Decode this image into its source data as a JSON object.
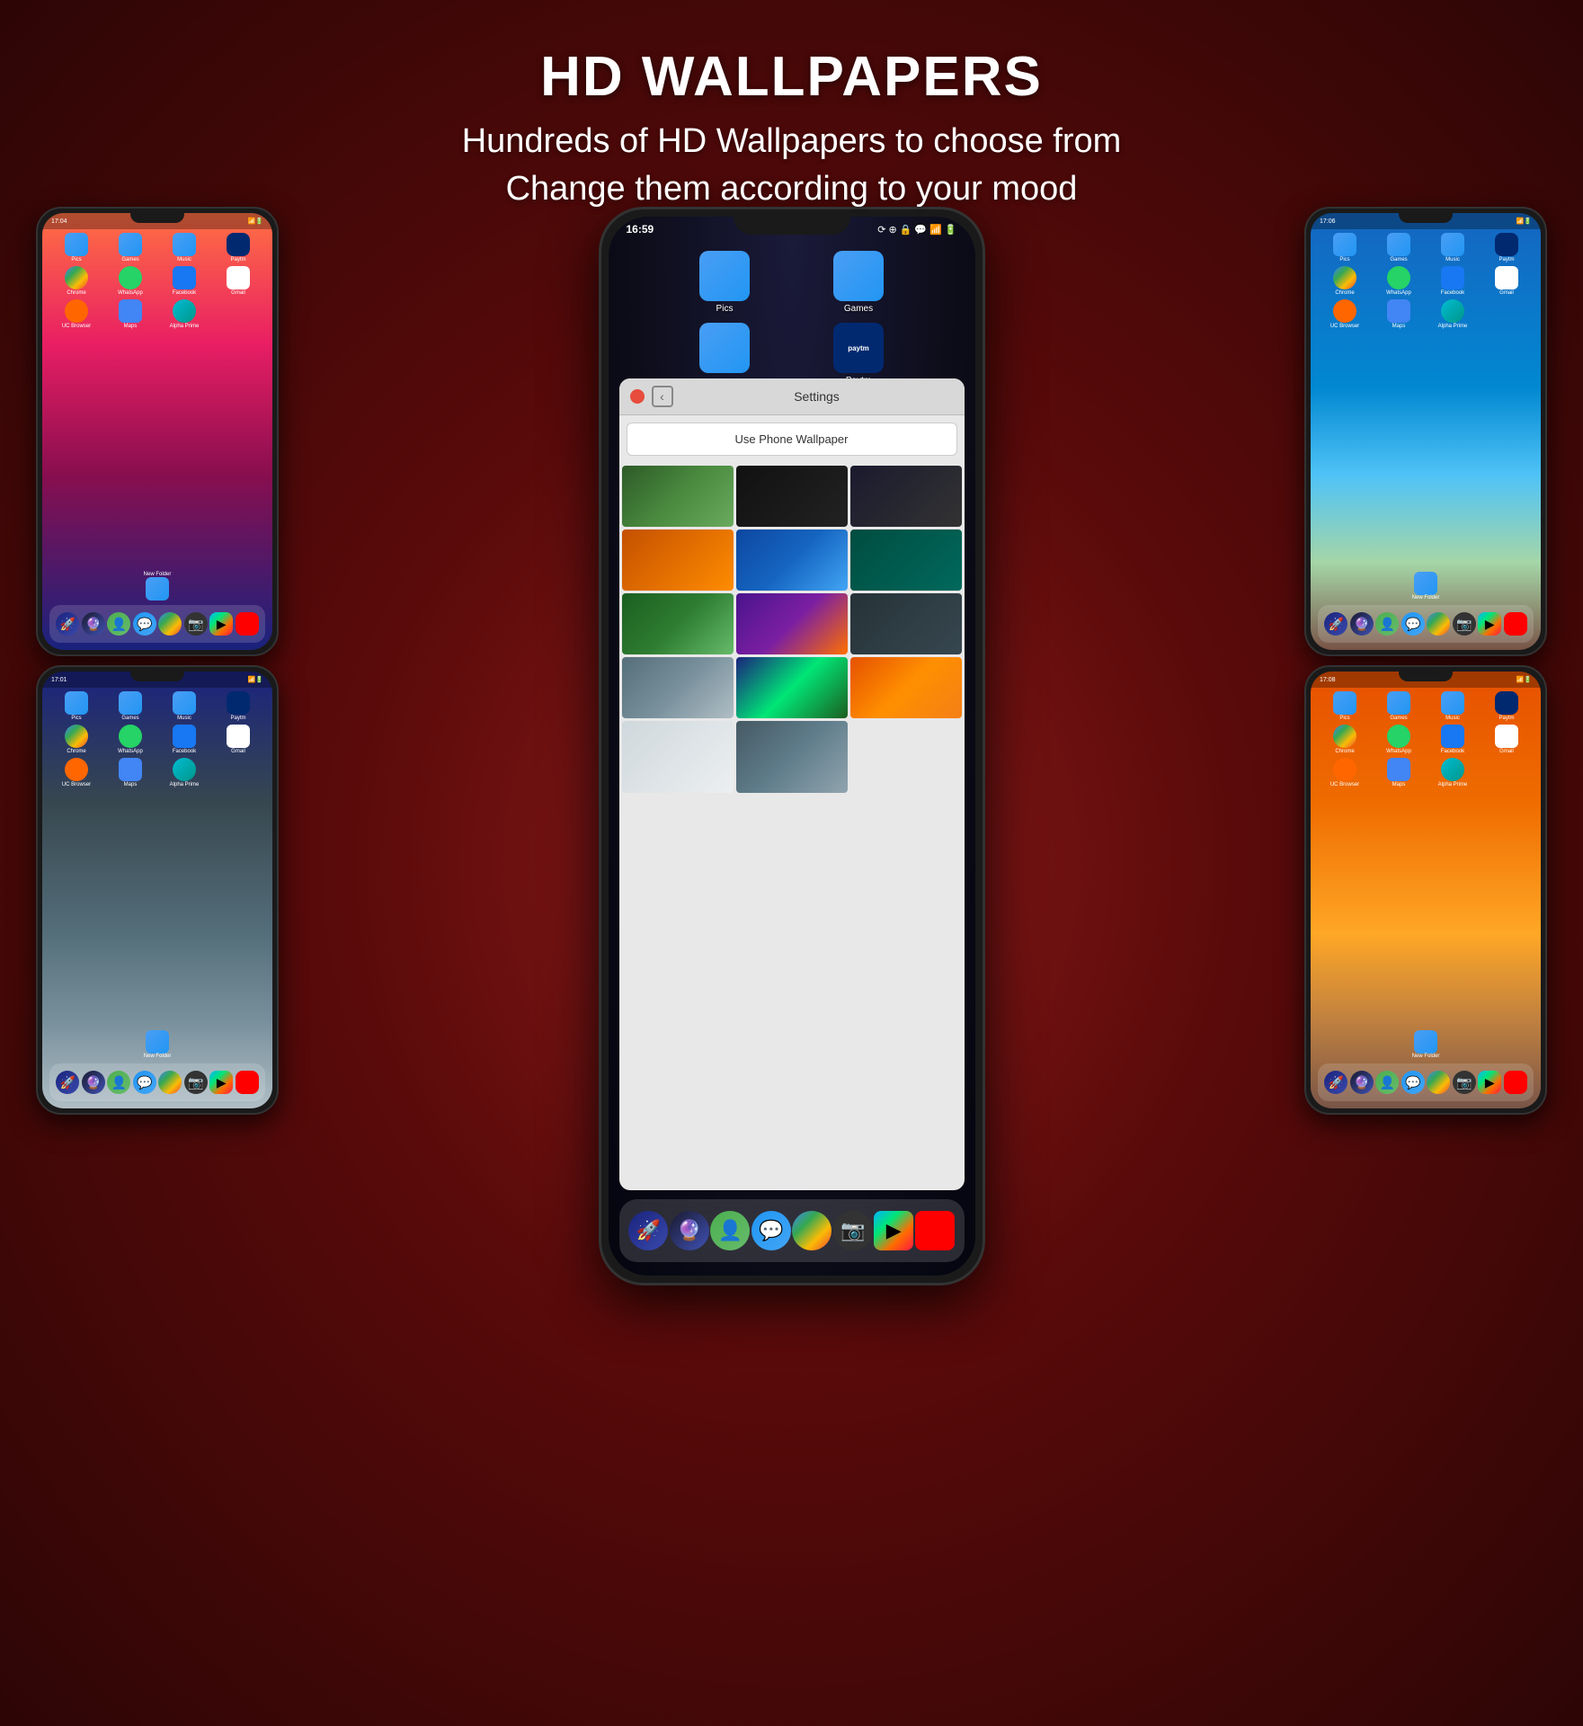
{
  "header": {
    "title": "HD WALLPAPERS",
    "subtitle_line1": "Hundreds of HD Wallpapers to choose from",
    "subtitle_line2": "Change them according to your mood"
  },
  "center_phone": {
    "status_time": "16:59",
    "folders": [
      {
        "label": "Pics"
      },
      {
        "label": "Games"
      },
      {
        "label": ""
      },
      {
        "label": ""
      }
    ],
    "settings": {
      "title": "Settings",
      "use_wallpaper_btn": "Use Phone Wallpaper"
    },
    "dock_icons": [
      "🚀",
      "🔮",
      "👤",
      "💬",
      "🌐",
      "📷",
      "▶",
      "🎬"
    ]
  },
  "top_left_phone": {
    "status_time": "17:04",
    "wallpaper": "sunset-boat",
    "apps": [
      {
        "label": "Pics"
      },
      {
        "label": "Games"
      },
      {
        "label": "Music"
      },
      {
        "label": "Paytm"
      },
      {
        "label": "Chrome"
      },
      {
        "label": "WhatsApp"
      },
      {
        "label": "Facebook"
      },
      {
        "label": "Gmail"
      },
      {
        "label": "UC Browser"
      },
      {
        "label": "Maps"
      },
      {
        "label": "Alpha Prime"
      },
      {
        "label": ""
      },
      {
        "label": "New Folder"
      }
    ]
  },
  "top_right_phone": {
    "status_time": "17:06",
    "wallpaper": "beach-cliff",
    "apps": [
      {
        "label": "Pics"
      },
      {
        "label": "Games"
      },
      {
        "label": "Music"
      },
      {
        "label": "Paytm"
      },
      {
        "label": "Chrome"
      },
      {
        "label": "WhatsApp"
      },
      {
        "label": "Facebook"
      },
      {
        "label": "Gmail"
      },
      {
        "label": "UC Browser"
      },
      {
        "label": "Maps"
      },
      {
        "label": "Alpha Prime"
      },
      {
        "label": ""
      },
      {
        "label": "New Folder"
      }
    ]
  },
  "bot_left_phone": {
    "status_time": "17:01",
    "wallpaper": "mountain-snow",
    "apps": [
      {
        "label": "Pics"
      },
      {
        "label": "Games"
      },
      {
        "label": "Music"
      },
      {
        "label": "Paytm"
      },
      {
        "label": "Chrome"
      },
      {
        "label": "WhatsApp"
      },
      {
        "label": "Facebook"
      },
      {
        "label": "Gmail"
      },
      {
        "label": "UC Browser"
      },
      {
        "label": "Maps"
      },
      {
        "label": "Alpha Prime"
      },
      {
        "label": ""
      },
      {
        "label": "New Folder"
      }
    ]
  },
  "bot_right_phone": {
    "status_time": "17:08",
    "wallpaper": "balloon-sunset",
    "apps": [
      {
        "label": "Pics"
      },
      {
        "label": "Games"
      },
      {
        "label": "Music"
      },
      {
        "label": "Paytm"
      },
      {
        "label": "Chrome"
      },
      {
        "label": "WhatsApp"
      },
      {
        "label": "Facebook"
      },
      {
        "label": "Gmail"
      },
      {
        "label": "UC Browser"
      },
      {
        "label": "Maps"
      },
      {
        "label": "Alpha Prime"
      },
      {
        "label": ""
      },
      {
        "label": "New Folder"
      }
    ]
  },
  "wallpaper_grid": [
    {
      "type": "wt-flowers",
      "label": "flowers"
    },
    {
      "type": "wt-dark",
      "label": "dark"
    },
    {
      "type": "wt-dark2",
      "label": "dark2"
    },
    {
      "type": "wt-orange",
      "label": "road"
    },
    {
      "type": "wt-ocean",
      "label": "ocean"
    },
    {
      "type": "wt-teal",
      "label": "teal"
    },
    {
      "type": "wt-forest",
      "label": "forest"
    },
    {
      "type": "wt-purple",
      "label": "purple-sunset"
    },
    {
      "type": "wt-city",
      "label": "city"
    },
    {
      "type": "wt-mountain",
      "label": "mountain-river"
    },
    {
      "type": "wt-aurora",
      "label": "aurora"
    },
    {
      "type": "wt-sunset",
      "label": "sunset-rocks"
    }
  ]
}
